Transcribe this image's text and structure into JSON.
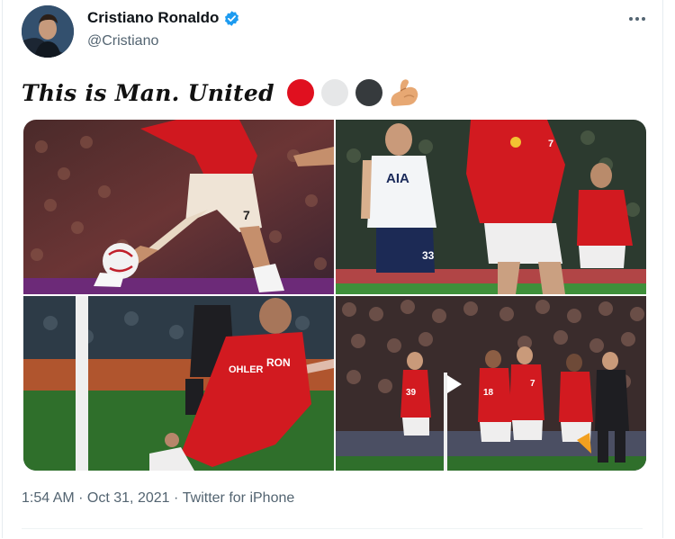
{
  "author": {
    "display_name": "Cristiano Ronaldo",
    "handle": "@Cristiano",
    "verified": true
  },
  "tweet": {
    "text": "This is Man. United",
    "emoji": [
      {
        "name": "red-circle",
        "color": "#e0101f"
      },
      {
        "name": "white-circle",
        "color": "#e6e7e8"
      },
      {
        "name": "black-circle",
        "color": "#363a3d"
      },
      {
        "name": "flexed-biceps"
      }
    ]
  },
  "media": [
    {
      "name": "photo-ronaldo-kicking-ball"
    },
    {
      "name": "photo-ronaldo-running-vs-tottenham"
    },
    {
      "name": "photo-ronaldo-knee-slide-celebration"
    },
    {
      "name": "photo-team-celebrating-with-fans"
    }
  ],
  "meta": {
    "time": "1:54 AM",
    "separator": " · ",
    "date": "Oct 31, 2021",
    "source": "Twitter for iPhone"
  },
  "colors": {
    "verified_blue": "#1d9bf0",
    "secondary_text": "#536471",
    "united_red": "#d7191f"
  }
}
